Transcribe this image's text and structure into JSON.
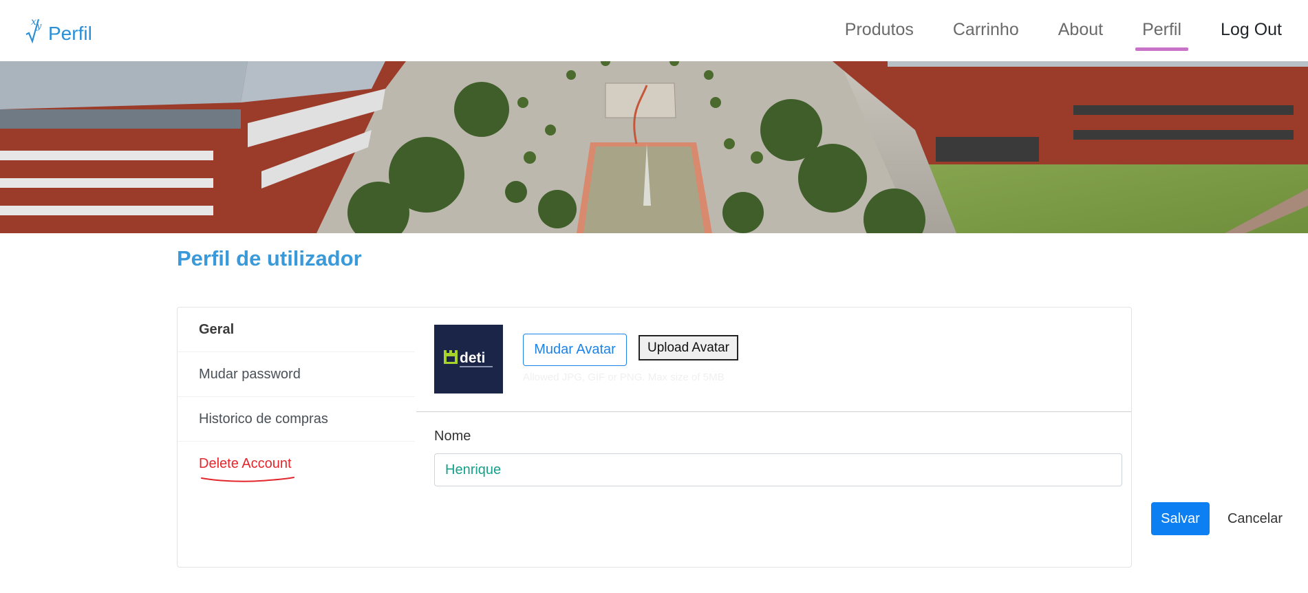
{
  "navbar": {
    "brand": {
      "text": "Perfil",
      "logo_icon": "xy-sqrt-logo-icon"
    },
    "links": [
      {
        "label": "Produtos"
      },
      {
        "label": "Carrinho"
      },
      {
        "label": "About"
      },
      {
        "label": "Perfil",
        "active": true
      },
      {
        "label": "Log Out"
      }
    ],
    "active_underline_color": "#c873c8"
  },
  "hero": {
    "subject": "campus courtyard aerial photo"
  },
  "page": {
    "title": "Perfil de utilizador"
  },
  "sidebar": {
    "items": [
      {
        "label": "Geral"
      },
      {
        "label": "Mudar password"
      },
      {
        "label": "Historico de compras"
      },
      {
        "label": "Delete Account"
      }
    ]
  },
  "avatar": {
    "logo_text": "deti",
    "change_label": "Mudar Avatar",
    "upload_label": "Upload Avatar",
    "hint": "Allowed JPG, GIF or PNG. Max size of 5MB"
  },
  "form": {
    "name_label": "Nome",
    "name_value": "Henrique",
    "save_label": "Salvar",
    "cancel_label": "Cancelar"
  },
  "colors": {
    "accent": "#3a9ad9",
    "primary_button": "#0c7ff2",
    "danger": "#e3262b",
    "input_text": "#16a089"
  }
}
